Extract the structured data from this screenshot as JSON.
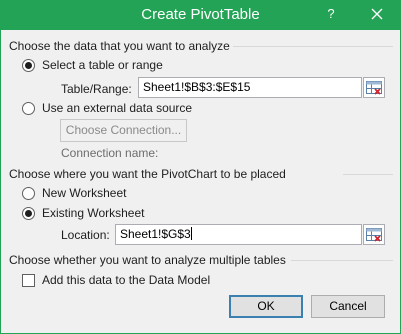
{
  "window": {
    "title": "Create PivotTable",
    "help_glyph": "?"
  },
  "data_section": {
    "heading": "Choose the data that you want to analyze",
    "select_table_option": "Select a table or range",
    "table_range_label": "Table/Range:",
    "table_range_value": "Sheet1!$B$3:$E$15",
    "external_source_option": "Use an external data source",
    "choose_connection_button": "Choose Connection...",
    "connection_name_label": "Connection name:"
  },
  "placement_section": {
    "heading": "Choose where you want the PivotChart to be placed",
    "new_worksheet_option": "New Worksheet",
    "existing_worksheet_option": "Existing Worksheet",
    "location_label": "Location:",
    "location_value": "Sheet1!$G$3"
  },
  "multiple_tables_section": {
    "heading": "Choose whether you want to analyze multiple tables",
    "add_to_data_model_label": "Add this data to the Data Model",
    "add_to_data_model_checked": false
  },
  "buttons": {
    "ok": "OK",
    "cancel": "Cancel"
  },
  "selection": {
    "data_source": "select_table",
    "placement": "existing_worksheet"
  },
  "colors": {
    "title_bar": "#22a355",
    "dialog_background": "#f0f0f0",
    "default_button_border": "#3c7fb1"
  },
  "icons": {
    "close": "close-icon",
    "range_selector": "range-selector-icon"
  }
}
